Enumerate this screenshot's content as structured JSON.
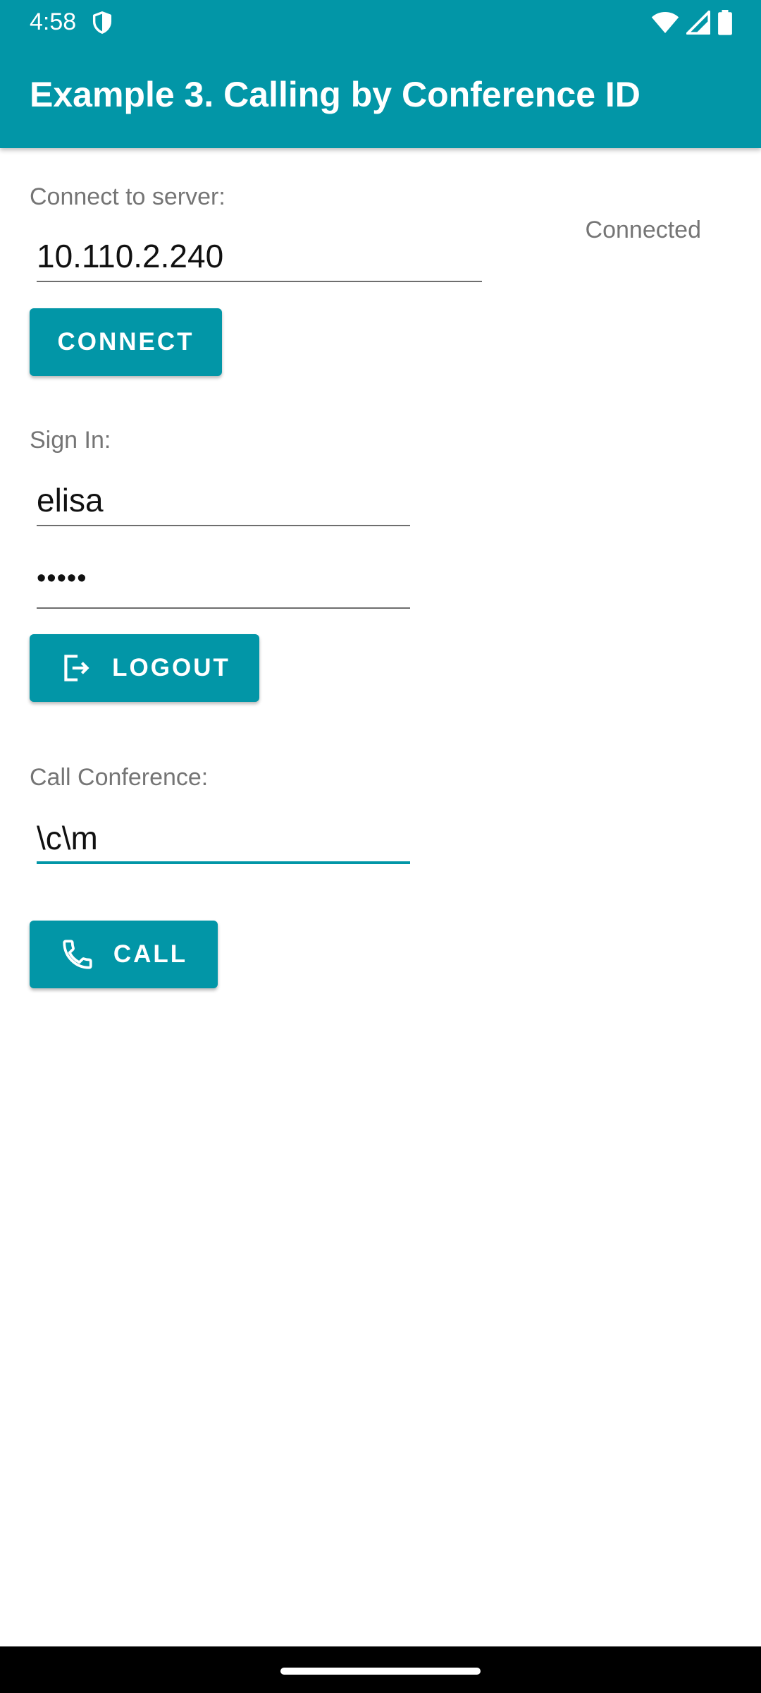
{
  "status_bar": {
    "time": "4:58",
    "icons": [
      "shield-icon",
      "wifi-icon",
      "signal-icon",
      "battery-icon"
    ]
  },
  "app_bar": {
    "title": "Example 3. Calling by Conference ID"
  },
  "server": {
    "label": "Connect to server:",
    "address": "10.110.2.240",
    "connection_status": "Connected",
    "connect_button": "CONNECT"
  },
  "sign_in": {
    "label": "Sign In:",
    "username": "elisa",
    "password_mask": "•••••",
    "logout_button": "LOGOUT",
    "logout_icon": "logout-icon"
  },
  "conference": {
    "label": "Call Conference:",
    "conference_id": "\\c\\m",
    "call_button": "CALL",
    "call_icon": "phone-icon"
  },
  "colors": {
    "accent": "#0296A7",
    "label_text": "#757575",
    "input_text": "#111111",
    "nav_bar": "#000000"
  }
}
